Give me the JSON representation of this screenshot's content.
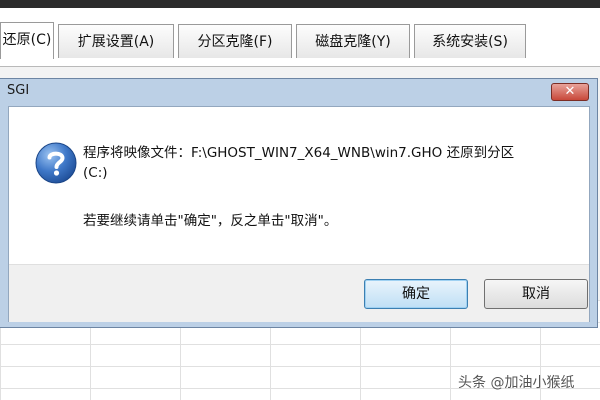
{
  "tabs": [
    {
      "label": "还原(C)"
    },
    {
      "label": "扩展设置(A)"
    },
    {
      "label": "分区克隆(F)"
    },
    {
      "label": "磁盘克隆(Y)"
    },
    {
      "label": "系统安装(S)"
    }
  ],
  "dialog": {
    "title": "SGI",
    "close_glyph": "✕",
    "message_line1": "程序将映像文件：F:\\GHOST_WIN7_X64_WNB\\win7.GHO 还原到分区",
    "message_line1b": "(C:)",
    "message_line2": "若要继续请单击\"确定\"，反之单击\"取消\"。",
    "ok_label": "确定",
    "cancel_label": "取消",
    "icon": "question-icon"
  },
  "watermark": "头条 @加油小猴纸",
  "colors": {
    "title_bar": "#bcd0e6",
    "close_button": "#c8483a",
    "primary_button_border": "#3c7fb1",
    "icon_blue": "#2f63b4"
  }
}
